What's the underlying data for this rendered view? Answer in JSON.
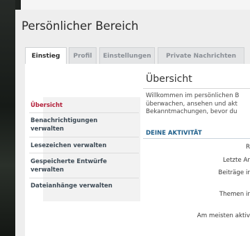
{
  "header": {
    "page_title": "Persönlicher Bereich"
  },
  "tabs": [
    {
      "label": "Einstieg",
      "active": true
    },
    {
      "label": "Profil"
    },
    {
      "label": "Einstellungen"
    },
    {
      "label": "Private Nachrichten"
    }
  ],
  "sidebar": {
    "items": [
      {
        "label": "Übersicht",
        "active": true
      },
      {
        "label_line1": "Benachrichtigungen",
        "label_line2": "verwalten"
      },
      {
        "label": "Lesezeichen verwalten"
      },
      {
        "label_line1": "Gespeicherte Entwürfe",
        "label_line2": "verwalten"
      },
      {
        "label": "Dateianhänge verwalten"
      }
    ]
  },
  "main": {
    "section_title": "Übersicht",
    "intro_lines": [
      "Willkommen im persönlichen B",
      "überwachen, ansehen und akt",
      "Bekanntmachungen, bevor du"
    ],
    "activity_heading": "DEINE AKTIVITÄT",
    "stats": [
      {
        "label": "R"
      },
      {
        "label": "Letzte Ar"
      },
      {
        "label": "Beiträge ir"
      },
      {
        "label": "Themen ir"
      },
      {
        "label": "Am meisten aktiv"
      }
    ]
  },
  "colors": {
    "active_nav": "#b3203a",
    "nav_text": "#3d4a55",
    "activity_heading": "#1f5f8b",
    "tab_text": "#8a8f96"
  }
}
